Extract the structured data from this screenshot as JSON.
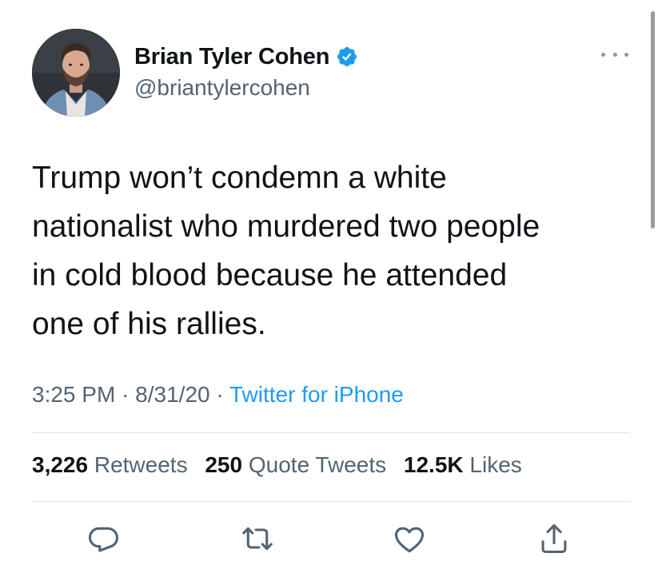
{
  "tweet": {
    "author": {
      "display_name": "Brian Tyler Cohen",
      "handle": "@briantylercohen",
      "verified_icon": "verified-badge-icon",
      "avatar_icon": "avatar"
    },
    "more_icon": "more-options-icon",
    "text": "Trump won’t condemn a white\nnationalist who murdered two people\nin cold blood because he attended\none of his rallies.",
    "time": "3:25 PM",
    "date": "8/31/20",
    "separator": "·",
    "source": "Twitter for iPhone",
    "stats": {
      "retweets_count": "3,226",
      "retweets_label": "Retweets",
      "quotes_count": "250",
      "quotes_label": "Quote Tweets",
      "likes_count": "12.5K",
      "likes_label": "Likes"
    },
    "actions": [
      "reply-icon",
      "retweet-icon",
      "like-icon",
      "share-icon"
    ]
  },
  "colors": {
    "text_primary": "#0f1419",
    "text_secondary": "#536471",
    "accent": "#1d9bf0",
    "divider": "#e1e5e8"
  }
}
